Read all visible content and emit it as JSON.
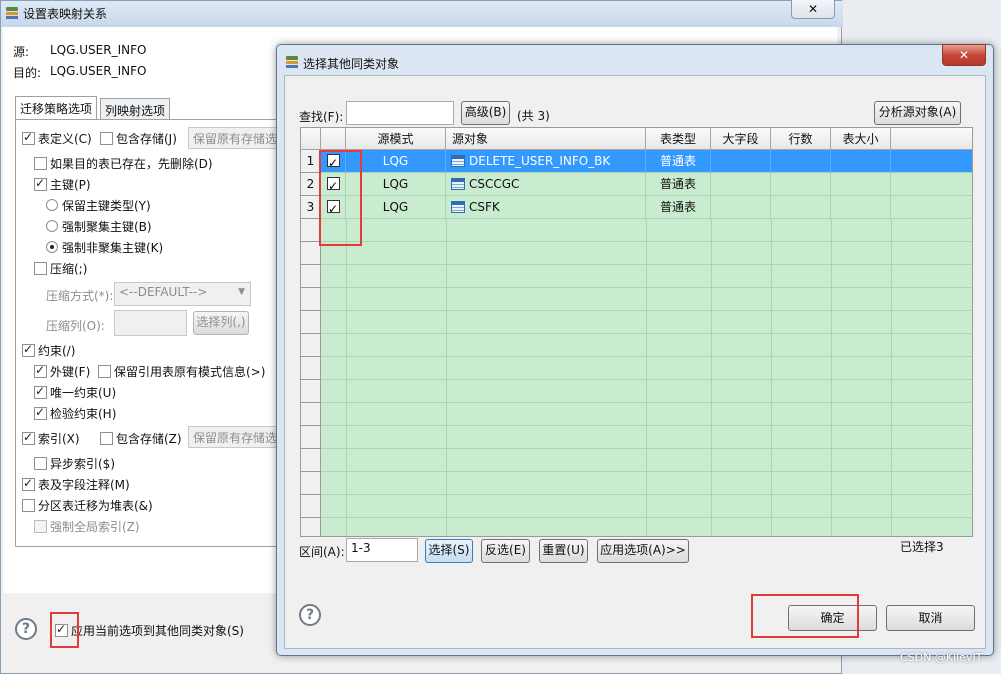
{
  "back_dialog": {
    "title": "设置表映射关系",
    "close": "✕",
    "source_label": "源:",
    "source_value": "LQG.USER_INFO",
    "target_label": "目的:",
    "target_value": "LQG.USER_INFO",
    "tabs": [
      "迁移策略选项",
      "列映射选项"
    ],
    "options": {
      "table_def": "表定义(C)",
      "include_storage": "包含存储(J)",
      "keep_storage_field": "保留原有存储选",
      "drop_if_exists": "如果目的表已存在，先删除(D)",
      "primary_key": "主键(P)",
      "keep_pk_type": "保留主键类型(Y)",
      "force_clustered_pk": "强制聚集主键(B)",
      "force_nonclustered_pk": "强制非聚集主键(K)",
      "compress": "压缩(;)",
      "compress_mode_label": "压缩方式(*):",
      "compress_mode_value": "<--DEFAULT-->",
      "compress_cols_label": "压缩列(O):",
      "select_cols_button": "选择列(,)",
      "constraints": "约束(/)",
      "foreign_key": "外键(F)",
      "keep_ref_schema": "保留引用表原有模式信息(>)",
      "unique": "唯一约束(U)",
      "check": "检验约束(H)",
      "index": "索引(X)",
      "index_include_storage": "包含存储(Z)",
      "index_keep_storage": "保留原有存储选",
      "async_index": "异步索引($)",
      "comments": "表及字段注释(M)",
      "partition_to_heap": "分区表迁移为堆表(&)",
      "force_global_index": "强制全局索引(Z)"
    },
    "apply_to_others": "应用当前选项到其他同类对象(S)",
    "help": "?"
  },
  "front_dialog": {
    "title": "选择其他同类对象",
    "close": "✕",
    "find_label": "查找(F):",
    "find_value": "",
    "advanced_button": "高级(B)",
    "count_text": "(共 3)",
    "analyze_button": "分析源对象(A)",
    "columns": [
      "源模式",
      "源对象",
      "表类型",
      "大字段",
      "行数",
      "表大小"
    ],
    "rows": [
      {
        "num": "1",
        "schema": "LQG",
        "object": "DELETE_USER_INFO_BK",
        "type": "普通表",
        "selected": true
      },
      {
        "num": "2",
        "schema": "LQG",
        "object": "CSCCGC",
        "type": "普通表",
        "selected": false
      },
      {
        "num": "3",
        "schema": "LQG",
        "object": "CSFK",
        "type": "普通表",
        "selected": false
      }
    ],
    "range_label": "区间(A):",
    "range_value": "1-3",
    "select_button": "选择(S)",
    "invert_button": "反选(E)",
    "reset_button": "重置(U)",
    "apply_options_button": "应用选项(A)>>",
    "selected_count": "已选择3",
    "ok_button": "确定",
    "cancel_button": "取消",
    "help": "?"
  },
  "watermark": "CSDN @KileyIT"
}
